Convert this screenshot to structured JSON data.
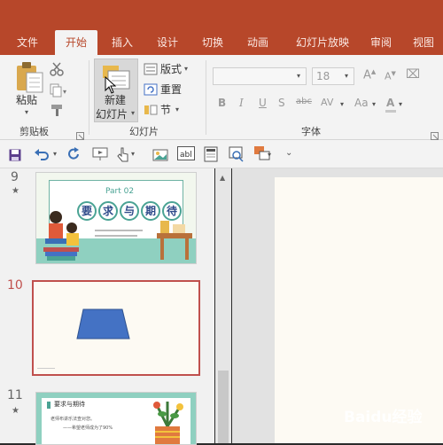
{
  "tabs": [
    "文件",
    "开始",
    "插入",
    "设计",
    "切换",
    "动画",
    "幻灯片放映",
    "审阅",
    "视图"
  ],
  "clipboard": {
    "paste_label": "粘贴",
    "group_label": "剪贴板"
  },
  "slides": {
    "new_slide_line1": "新建",
    "new_slide_line2": "幻灯片",
    "layout_label": "版式",
    "reset_label": "重置",
    "section_label": "节",
    "group_label": "幻灯片"
  },
  "font": {
    "font_name_value": "",
    "font_size_value": "18",
    "bold": "B",
    "italic": "I",
    "underline": "U",
    "strike": "S",
    "char_spacing": "AV",
    "change_case": "Aa",
    "group_label": "字体"
  },
  "thumbnails": [
    {
      "number": "9",
      "part_label": "Part 02",
      "title_chars": [
        "要",
        "求",
        "与",
        "期",
        "待"
      ]
    },
    {
      "number": "10"
    },
    {
      "number": "11",
      "heading": "要求与期待",
      "line1": "老师布讲乐法查对您。",
      "line2": "——希望老师成为了90%"
    }
  ],
  "watermark": "Baidu经验",
  "colors": {
    "accent": "#b7472a",
    "selected_border": "#c0504d",
    "trapezoid": "#4472c4",
    "teal": "#4aa394"
  }
}
